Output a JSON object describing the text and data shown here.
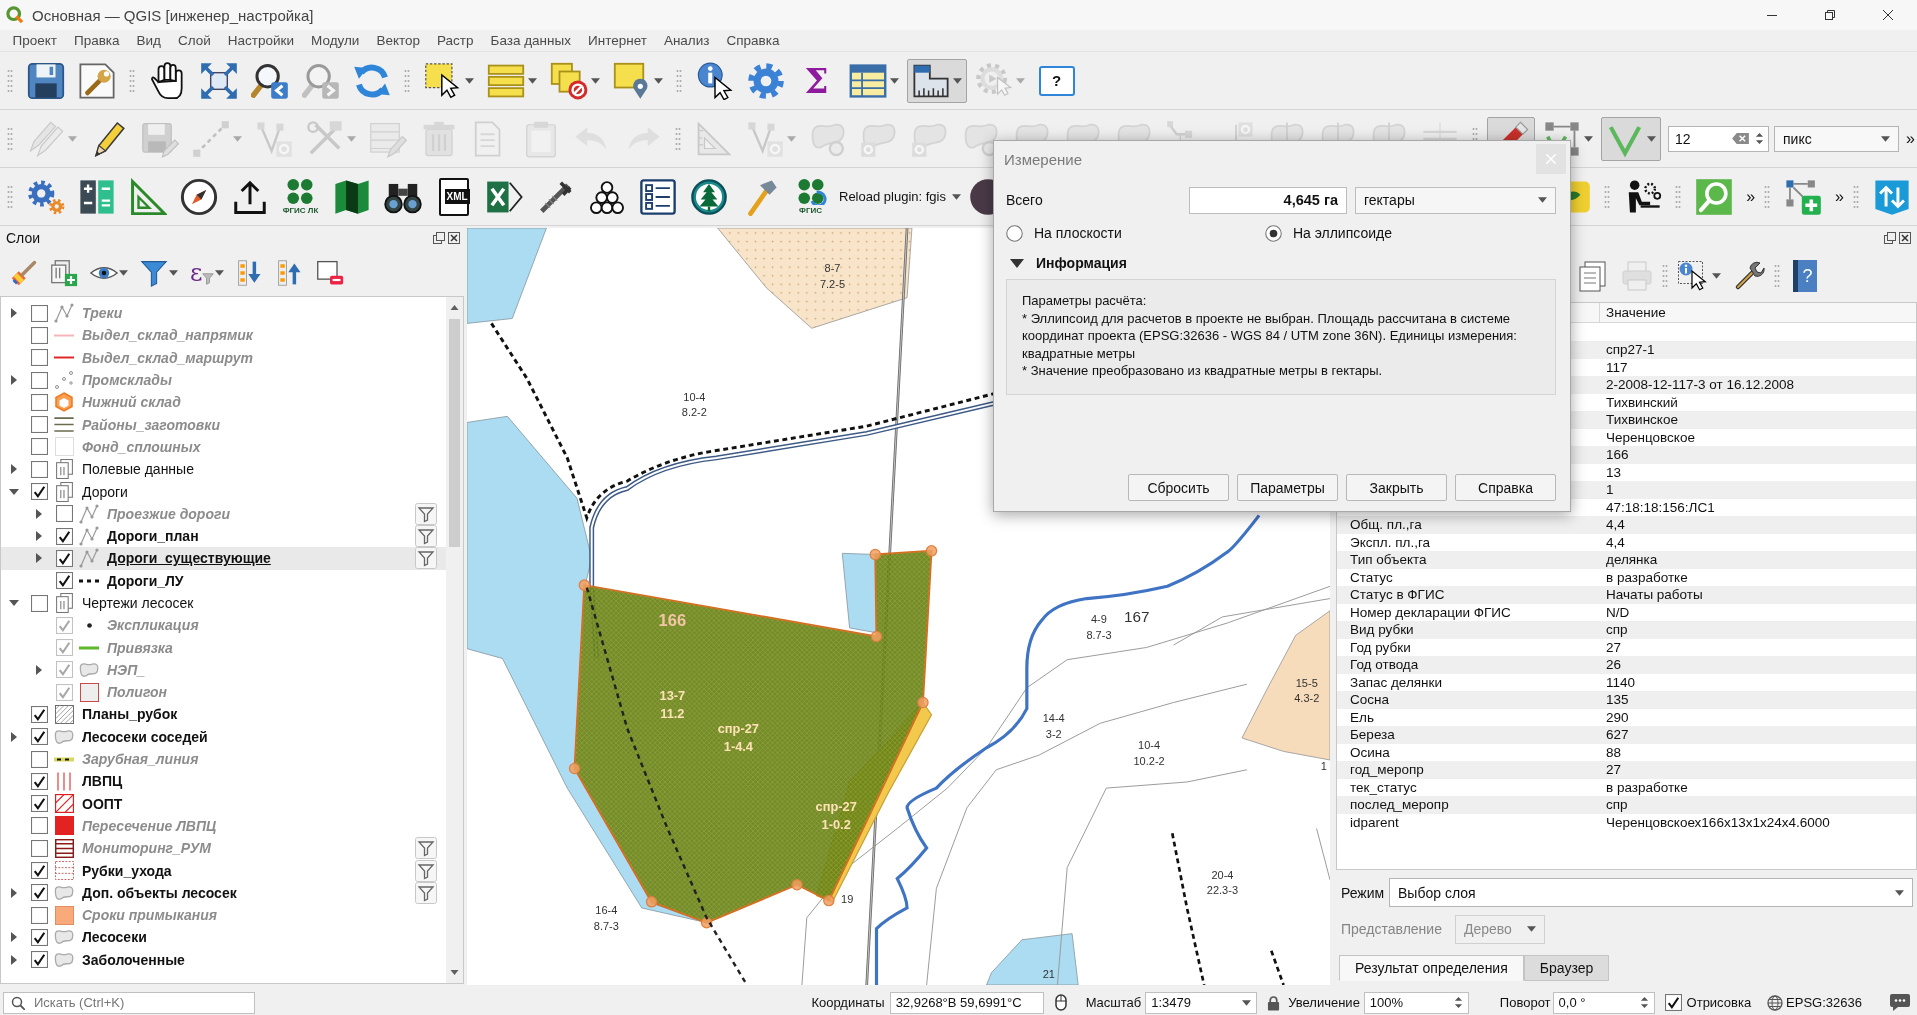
{
  "window": {
    "title": "Основная — QGIS [инженер_настройка]"
  },
  "menu": [
    "Проект",
    "Правка",
    "Вид",
    "Слой",
    "Настройки",
    "Модули",
    "Вектор",
    "Растр",
    "База данных",
    "Интернет",
    "Анализ",
    "Справка"
  ],
  "toolbar_main": {
    "buttons": [
      {
        "disabled": false,
        "checked": false,
        "dropdown": false
      },
      {
        "disabled": false,
        "checked": false,
        "dropdown": false
      },
      {
        "disabled": false,
        "checked": false,
        "dropdown": false
      },
      {
        "disabled": false,
        "checked": false,
        "dropdown": false
      },
      {
        "disabled": false,
        "checked": false,
        "dropdown": false
      },
      {
        "disabled": true,
        "checked": false,
        "dropdown": false
      },
      {
        "disabled": false,
        "checked": false,
        "dropdown": false
      },
      {
        "disabled": false,
        "checked": false,
        "dropdown": true
      },
      {
        "disabled": false,
        "checked": false,
        "dropdown": true
      },
      {
        "disabled": false,
        "checked": false,
        "dropdown": true
      },
      {
        "disabled": false,
        "checked": false,
        "dropdown": true
      },
      {
        "disabled": false,
        "checked": false,
        "dropdown": false
      },
      {
        "disabled": false,
        "checked": false,
        "dropdown": false
      },
      {
        "label": "Σ",
        "disabled": false,
        "checked": false,
        "dropdown": false
      },
      {
        "disabled": false,
        "checked": false,
        "dropdown": true
      },
      {
        "disabled": false,
        "checked": true,
        "dropdown": true
      },
      {
        "disabled": true,
        "checked": false,
        "dropdown": true
      },
      {
        "label": "?",
        "disabled": false,
        "checked": false,
        "dropdown": false
      }
    ]
  },
  "toolbar_editing": {
    "buttons": [
      {
        "disabled": true,
        "checked": false,
        "dropdown": true
      },
      {
        "disabled": false,
        "checked": false,
        "dropdown": false
      },
      {
        "disabled": true,
        "checked": false,
        "dropdown": false
      },
      {
        "disabled": true,
        "checked": false,
        "dropdown": true
      },
      {
        "disabled": true,
        "checked": false,
        "dropdown": false
      },
      {
        "disabled": true,
        "checked": false,
        "dropdown": true
      },
      {
        "disabled": true,
        "checked": false,
        "dropdown": false
      },
      {
        "disabled": true,
        "checked": false,
        "dropdown": false
      },
      {
        "disabled": true,
        "checked": false,
        "dropdown": false
      },
      {
        "disabled": true,
        "checked": false,
        "dropdown": false
      },
      {
        "disabled": true,
        "checked": false,
        "dropdown": false
      },
      {
        "disabled": true,
        "checked": false,
        "dropdown": false
      },
      {
        "disabled": true,
        "checked": false,
        "dropdown": false
      },
      {
        "disabled": true,
        "checked": false,
        "dropdown": true
      },
      {
        "disabled": true,
        "checked": false,
        "dropdown": false
      },
      {
        "disabled": true,
        "checked": false,
        "dropdown": false
      },
      {
        "disabled": true,
        "checked": false,
        "dropdown": false
      },
      {
        "disabled": true,
        "checked": false,
        "dropdown": false
      },
      {
        "disabled": true,
        "checked": false,
        "dropdown": false
      },
      {
        "disabled": true,
        "checked": false,
        "dropdown": false
      },
      {
        "disabled": true,
        "checked": false,
        "dropdown": false
      },
      {
        "disabled": true,
        "checked": false,
        "dropdown": false
      },
      {
        "disabled": true,
        "checked": false,
        "dropdown": false
      },
      {
        "disabled": true,
        "checked": false,
        "dropdown": false
      },
      {
        "disabled": true,
        "checked": false,
        "dropdown": false
      },
      {
        "disabled": true,
        "checked": false,
        "dropdown": false
      },
      {
        "disabled": true,
        "checked": false,
        "dropdown": false
      },
      {
        "disabled": false,
        "checked": true,
        "dropdown": false
      },
      {
        "disabled": false,
        "checked": false,
        "dropdown": true
      },
      {
        "disabled": false,
        "checked": true,
        "dropdown": true
      }
    ],
    "tolerance": {
      "value": "12"
    },
    "units": {
      "value": "пикс"
    },
    "overflow": "»"
  },
  "toolbar_plugins": {
    "buttons": [
      {
        "disabled": false
      },
      {
        "disabled": false
      },
      {
        "disabled": false
      },
      {
        "disabled": false
      },
      {
        "disabled": false
      },
      {
        "label": "ФГИС ЛК",
        "disabled": false
      },
      {
        "disabled": false
      },
      {
        "disabled": false
      },
      {
        "label": "XML",
        "disabled": false
      },
      {
        "disabled": false
      },
      {
        "disabled": false
      },
      {
        "disabled": false
      },
      {
        "disabled": false
      },
      {
        "disabled": false
      },
      {
        "disabled": false
      },
      {
        "label": "ФГИС",
        "disabled": false
      }
    ],
    "plugin_combo": {
      "value": "Reload plugin: fgis"
    },
    "extra_toolbars": [
      {
        "buttons": [
          {
            "disabled": false
          }
        ]
      },
      {
        "buttons": [
          {
            "disabled": false
          }
        ]
      },
      {
        "buttons": [
          {
            "disabled": false
          }
        ]
      },
      {
        "buttons": [
          {
            "disabled": false
          }
        ],
        "overflow": "»"
      },
      {
        "buttons": [
          {
            "disabled": false
          }
        ],
        "overflow": "»"
      },
      {
        "buttons": [
          {
            "disabled": false
          }
        ]
      }
    ]
  },
  "layers_panel": {
    "title": "Слои",
    "toolbar": [
      {
        "dropdown": false
      },
      {
        "dropdown": false
      },
      {
        "dropdown": true
      },
      {
        "dropdown": true
      },
      {
        "label": "ε",
        "dropdown": true
      },
      {
        "dropdown": false
      },
      {
        "dropdown": false
      },
      {
        "dropdown": false
      }
    ],
    "items": [
      {
        "kind": "layer",
        "name": "Треки",
        "checked": false,
        "expanded": false,
        "filtered": false,
        "selected": false
      },
      {
        "kind": "layer",
        "name": "Выдел_склад_напрямик",
        "checked": false,
        "filtered": false,
        "selected": false
      },
      {
        "kind": "layer",
        "name": "Выдел_склад_маршрут",
        "checked": false,
        "filtered": false,
        "selected": false
      },
      {
        "kind": "layer",
        "name": "Промсклады",
        "checked": false,
        "expanded": false,
        "filtered": false,
        "selected": false
      },
      {
        "kind": "layer",
        "name": "Нижний склад",
        "checked": false,
        "filtered": false,
        "selected": false
      },
      {
        "kind": "layer",
        "name": "Районы_заготовки",
        "checked": false,
        "filtered": false,
        "selected": false
      },
      {
        "kind": "layer",
        "name": "Фонд_сплошных",
        "checked": false,
        "filtered": false,
        "selected": false
      },
      {
        "kind": "group",
        "name": "Полевые данные",
        "checked": false,
        "expanded": false,
        "selected": false
      },
      {
        "kind": "group",
        "name": "Дороги",
        "checked": true,
        "expanded": true,
        "selected": false,
        "children": [
          {
            "kind": "layer",
            "name": "Проезжие дороги",
            "checked": false,
            "expanded": false,
            "filtered": true,
            "selected": false
          },
          {
            "kind": "layer",
            "name": "Дороги_план",
            "checked": true,
            "expanded": false,
            "filtered": true,
            "selected": false
          },
          {
            "kind": "layer",
            "name": "Дороги_существующие",
            "checked": true,
            "expanded": false,
            "filtered": true,
            "selected": true
          },
          {
            "kind": "layer",
            "name": "Дороги_ЛУ",
            "checked": true,
            "filtered": false,
            "selected": false
          }
        ]
      },
      {
        "kind": "group",
        "name": "Чертежи лесосек",
        "checked": false,
        "expanded": true,
        "selected": false,
        "children": [
          {
            "kind": "layer",
            "name": "Экспликация",
            "checked": true,
            "filtered": false,
            "selected": false
          },
          {
            "kind": "layer",
            "name": "Привязка",
            "checked": true,
            "filtered": false,
            "selected": false
          },
          {
            "kind": "layer",
            "name": "НЭП_",
            "checked": true,
            "expanded": false,
            "filtered": false,
            "selected": false
          },
          {
            "kind": "layer",
            "name": "Полигон",
            "checked": true,
            "filtered": false,
            "selected": false
          }
        ]
      },
      {
        "kind": "layer",
        "name": "Планы_рубок",
        "checked": true,
        "filtered": false,
        "selected": false
      },
      {
        "kind": "layer",
        "name": "Лесосеки соседей",
        "checked": true,
        "expanded": false,
        "filtered": false,
        "selected": false
      },
      {
        "kind": "layer",
        "name": "Зарубная_линия",
        "checked": false,
        "filtered": false,
        "selected": false
      },
      {
        "kind": "layer",
        "name": "ЛВПЦ",
        "checked": true,
        "filtered": false,
        "selected": false
      },
      {
        "kind": "layer",
        "name": "ООПТ",
        "checked": true,
        "filtered": false,
        "selected": false
      },
      {
        "kind": "layer",
        "name": "Пересечение ЛВПЦ",
        "checked": false,
        "filtered": false,
        "selected": false
      },
      {
        "kind": "layer",
        "name": "Мониторинг_РУМ",
        "checked": false,
        "filtered": true,
        "selected": false
      },
      {
        "kind": "layer",
        "name": "Рубки_ухода",
        "checked": true,
        "filtered": true,
        "selected": false
      },
      {
        "kind": "layer",
        "name": "Доп. объекты лесосек",
        "checked": true,
        "expanded": false,
        "filtered": true,
        "selected": false
      },
      {
        "kind": "layer",
        "name": "Сроки примыкания",
        "checked": false,
        "filtered": false,
        "selected": false
      },
      {
        "kind": "layer",
        "name": "Лесосеки",
        "checked": true,
        "expanded": false,
        "filtered": false,
        "selected": false
      },
      {
        "kind": "layer",
        "name": "Заболоченные",
        "checked": true,
        "expanded": false,
        "filtered": false,
        "selected": false
      }
    ]
  },
  "map": {
    "labels": [
      {
        "kind": "stand",
        "lines": [
          "8-7",
          "7.2-5"
        ]
      },
      {
        "kind": "stand",
        "lines": [
          "10-4",
          "8.2-2"
        ]
      },
      {
        "kind": "plot_number",
        "lines": [
          "166"
        ]
      },
      {
        "kind": "plot",
        "lines": [
          "13-7",
          "11.2"
        ]
      },
      {
        "kind": "plot",
        "lines": [
          "спр-27",
          "1-4.4"
        ]
      },
      {
        "kind": "plot",
        "lines": [
          "спр-27",
          "1-0.2"
        ]
      },
      {
        "kind": "stand",
        "lines": [
          "19"
        ]
      },
      {
        "kind": "stand",
        "lines": [
          "16-4",
          "8.7-3"
        ]
      },
      {
        "kind": "stand",
        "lines": [
          "4-9",
          "8.7-3"
        ]
      },
      {
        "kind": "number",
        "lines": [
          "167"
        ]
      },
      {
        "kind": "stand",
        "lines": [
          "14-4",
          "3-2"
        ]
      },
      {
        "kind": "stand",
        "lines": [
          "10-4",
          "10.2-2"
        ]
      },
      {
        "kind": "stand",
        "lines": [
          "15-5",
          "4.3-2"
        ]
      },
      {
        "kind": "stand",
        "lines": [
          "20-4",
          "22.3-3"
        ]
      },
      {
        "kind": "stand",
        "lines": [
          "21"
        ]
      },
      {
        "kind": "stand",
        "lines": [
          "1"
        ]
      }
    ]
  },
  "identify_panel": {
    "toolbar": [
      {
        "disabled": false,
        "dropdown": false
      },
      {
        "disabled": true,
        "dropdown": false
      },
      {
        "disabled": false,
        "dropdown": true
      },
      {
        "disabled": false,
        "dropdown": false
      },
      {
        "label": "?",
        "disabled": false,
        "dropdown": false
      }
    ],
    "header": {
      "value": "Значение"
    },
    "rows": [
      {
        "value": "спр27-1"
      },
      {
        "value": "117"
      },
      {
        "value": "2-2008-12-117-3 от 16.12.2008"
      },
      {
        "value": "Тихвинский"
      },
      {
        "value": "Тихвинское"
      },
      {
        "value": "Черенцовское"
      },
      {
        "value": "166"
      },
      {
        "value": "13"
      },
      {
        "value": "1"
      },
      {
        "value": "47:18:18:156:ЛС1"
      },
      {
        "field": "Общ. пл.,га",
        "value": "4,4"
      },
      {
        "field": "Экспл. пл.,га",
        "value": "4,4"
      },
      {
        "field": "Тип объекта",
        "value": "делянка"
      },
      {
        "field": "Статус",
        "value": "в разработке"
      },
      {
        "field": "Статус в ФГИС",
        "value": "Начаты работы"
      },
      {
        "field": "Номер декларации ФГИС",
        "value": "N/D"
      },
      {
        "field": "Вид рубки",
        "value": "спр"
      },
      {
        "field": "Год рубки",
        "value": "27"
      },
      {
        "field": "Год отвода",
        "value": "26"
      },
      {
        "field": "Запас делянки",
        "value": "1140"
      },
      {
        "field": "Сосна",
        "value": "135"
      },
      {
        "field": "Ель",
        "value": "290"
      },
      {
        "field": "Береза",
        "value": "627"
      },
      {
        "field": "Осина",
        "value": "88"
      },
      {
        "field": "год_меропр",
        "value": "27"
      },
      {
        "field": "тек_статус",
        "value": "в разработке"
      },
      {
        "field": "послед_меропр",
        "value": "спр"
      },
      {
        "field": "idparent",
        "value": "Черенцовскоех166х13х1х24х4.6000"
      }
    ],
    "mode": {
      "label": "Режим",
      "value": "Выбор слоя"
    },
    "view": {
      "label": "Представление",
      "value": "Дерево",
      "disabled": true
    },
    "tabs": [
      {
        "label": "Результат определения",
        "selected": true
      },
      {
        "label": "Браузер",
        "selected": false
      }
    ]
  },
  "status_bar": {
    "search": {
      "placeholder": "Искать (Ctrl+K)"
    },
    "coordinate": {
      "label": "Координаты",
      "value": "32,9268°В 59,6991°С"
    },
    "scale": {
      "label": "Масштаб",
      "value": "1:3479"
    },
    "magnification": {
      "label": "Увеличение",
      "value": "100%"
    },
    "rotation": {
      "label": "Поворот",
      "value": "0,0 °"
    },
    "render": {
      "label": "Отрисовка",
      "checked": true
    },
    "crs": {
      "label": "EPSG:32636"
    }
  },
  "measure_dialog": {
    "title": "Измерение",
    "total": {
      "label": "Всего",
      "value": "4,645 га",
      "units": "гектары"
    },
    "modes": [
      {
        "label": "На плоскости",
        "selected": false
      },
      {
        "label": "На эллипсоиде",
        "selected": true
      }
    ],
    "info": {
      "title": "Информация",
      "expanded": true,
      "lines": [
        "Параметры расчёта:",
        "* Эллипсоид для расчетов в проекте не выбран. Площадь рассчитана в системе координат проекта (EPSG:32636 - WGS 84 / UTM zone 36N). Единицы измерения: квадратные метры",
        "* Значение преобразовано из квадратные метры в гектары."
      ]
    },
    "buttons": [
      "Сбросить",
      "Параметры",
      "Закрыть",
      "Справка"
    ]
  }
}
